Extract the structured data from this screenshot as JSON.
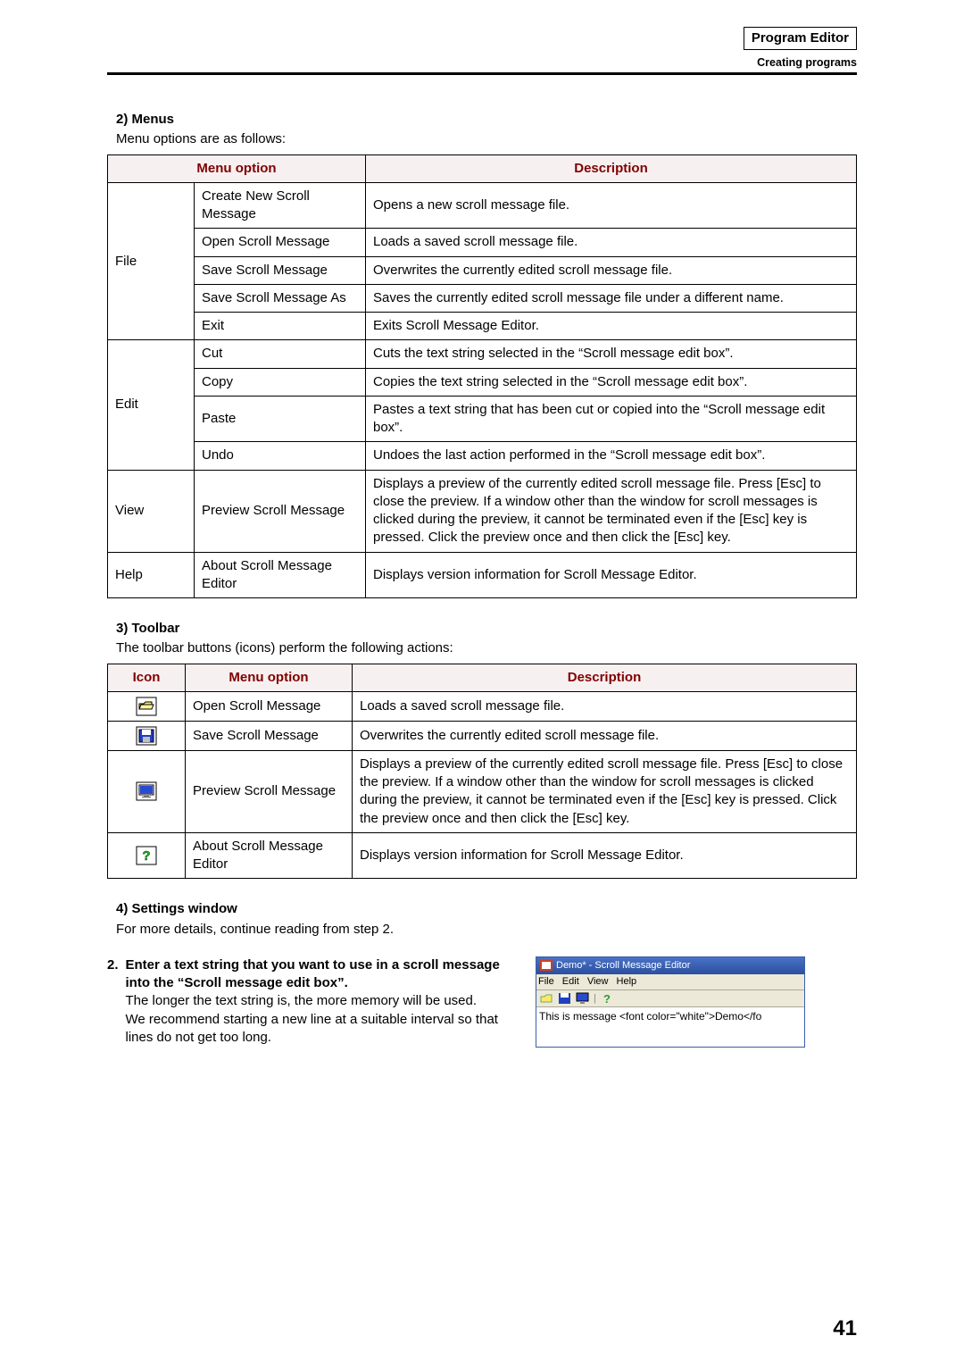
{
  "header": {
    "title": "Program Editor",
    "sub": "Creating programs"
  },
  "menus": {
    "heading": "2) Menus",
    "sub": "Menu options are as follows:",
    "cols": {
      "menu": "Menu option",
      "desc": "Description"
    },
    "groups": [
      {
        "top": "File",
        "rows": [
          {
            "opt": "Create New Scroll Message",
            "desc": "Opens a new scroll message file."
          },
          {
            "opt": "Open Scroll Message",
            "desc": "Loads a saved scroll message file."
          },
          {
            "opt": "Save Scroll Message",
            "desc": "Overwrites the currently edited scroll message file."
          },
          {
            "opt": "Save Scroll Message As",
            "desc": "Saves the currently edited scroll message file under a different name."
          },
          {
            "opt": "Exit",
            "desc": "Exits Scroll Message Editor."
          }
        ]
      },
      {
        "top": "Edit",
        "rows": [
          {
            "opt": "Cut",
            "desc": "Cuts the text string selected in the “Scroll message edit box”."
          },
          {
            "opt": "Copy",
            "desc": "Copies the text string selected in the “Scroll message edit box”."
          },
          {
            "opt": "Paste",
            "desc": "Pastes a text string that has been cut or copied into the “Scroll message edit box”."
          },
          {
            "opt": "Undo",
            "desc": "Undoes the last action performed in the “Scroll message edit box”."
          }
        ]
      },
      {
        "top": "View",
        "rows": [
          {
            "opt": "Preview Scroll Message",
            "desc": "Displays a preview of the currently edited scroll message file. Press [Esc] to close the preview. If a window other than the window for scroll messages is clicked during the preview, it cannot be terminated even if the [Esc] key is pressed. Click the preview once and then click the [Esc] key."
          }
        ]
      },
      {
        "top": "Help",
        "rows": [
          {
            "opt": "About Scroll Message Editor",
            "desc": "Displays version information for Scroll Message Editor."
          }
        ]
      }
    ]
  },
  "toolbar": {
    "heading": "3) Toolbar",
    "sub": "The toolbar buttons (icons) perform the following actions:",
    "cols": {
      "icon": "Icon",
      "menu": "Menu option",
      "desc": "Description"
    },
    "rows": [
      {
        "icon": "open-icon",
        "opt": "Open Scroll Message",
        "desc": "Loads a saved scroll message file."
      },
      {
        "icon": "save-icon",
        "opt": "Save Scroll Message",
        "desc": "Overwrites the currently edited scroll message file."
      },
      {
        "icon": "preview-icon",
        "opt": "Preview Scroll Message",
        "desc": "Displays a preview of the currently edited scroll message file. Press [Esc] to close the preview. If a window other than the window for scroll messages is clicked during the preview, it cannot be terminated even if the [Esc] key is pressed. Click the preview once and then click the [Esc] key."
      },
      {
        "icon": "help-icon",
        "opt": "About Scroll Message Editor",
        "desc": "Displays version information for Scroll Message Editor."
      }
    ]
  },
  "settings": {
    "heading": "4) Settings window",
    "sub": "For more details, continue reading from step 2."
  },
  "step2": {
    "num": "2.",
    "head": "Enter a text string that you want to use in a scroll message into the “Scroll message edit box”.",
    "body1": "The longer the text string is, the more memory will be used.",
    "body2": "We recommend starting a new line at a suitable interval so that lines do not get too long."
  },
  "mock": {
    "title": "Demo* - Scroll Message Editor",
    "menu": {
      "file": "File",
      "edit": "Edit",
      "view": "View",
      "help": "Help"
    },
    "body": "This is message <font color=\"white\">Demo</fo"
  },
  "page": "41"
}
